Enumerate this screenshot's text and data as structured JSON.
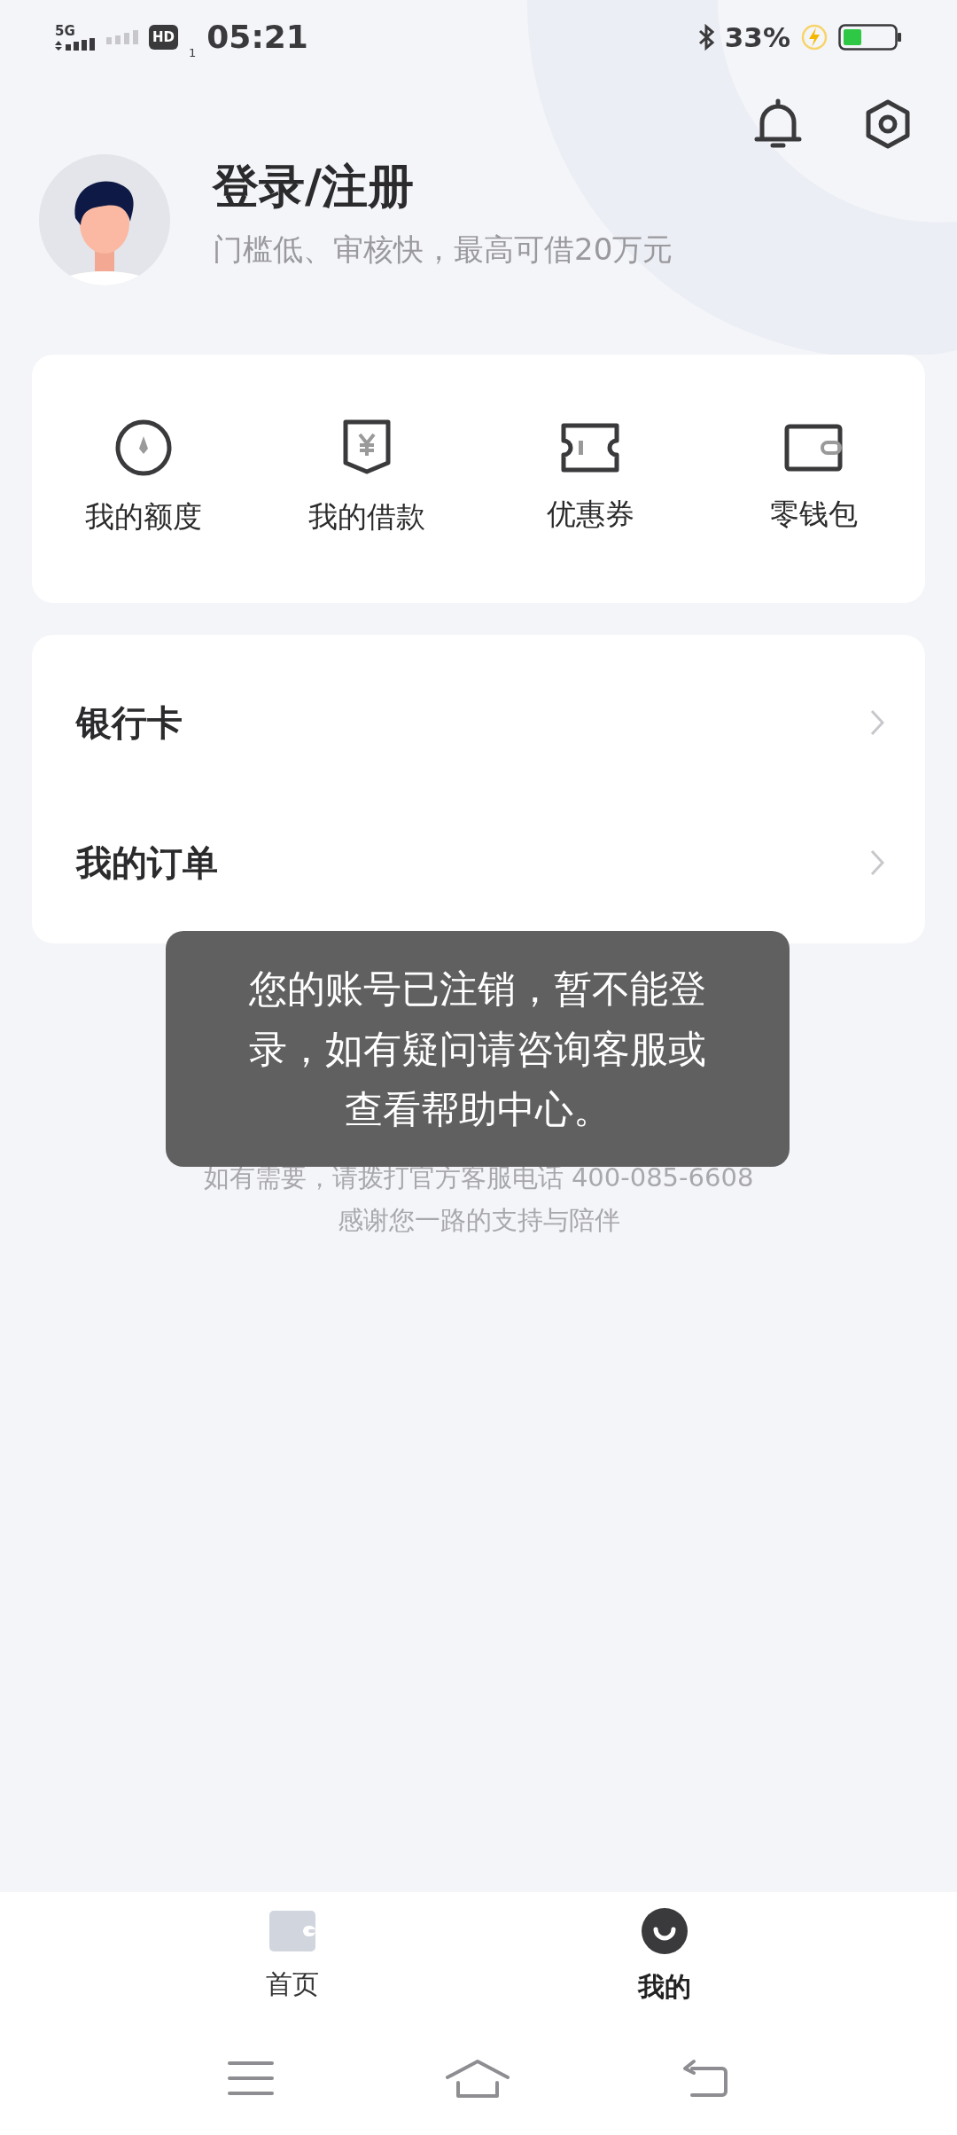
{
  "status_bar": {
    "network": "5G",
    "hd": "HD",
    "sim": "1",
    "time": "05:21",
    "battery_percent": "33%"
  },
  "profile": {
    "title": "登录/注册",
    "subtitle": "门槛低、审核快，最高可借20万元"
  },
  "shortcuts": [
    {
      "kind": "quota",
      "label": "我的额度"
    },
    {
      "kind": "loan",
      "label": "我的借款"
    },
    {
      "kind": "coupon",
      "label": "优惠券"
    },
    {
      "kind": "wallet",
      "label": "零钱包"
    }
  ],
  "menu": [
    {
      "label": "银行卡"
    },
    {
      "label": "我的订单"
    }
  ],
  "toast": {
    "message": "您的账号已注销，暂不能登录，如有疑问请咨询客服或查看帮助中心。"
  },
  "footer": {
    "lines": [
      "如有需要，请拨打官方客服电话 400-085-6608",
      "感谢您一路的支持与陪伴"
    ]
  },
  "tabs": [
    {
      "kind": "home",
      "label": "首页",
      "selected": false
    },
    {
      "kind": "mine",
      "label": "我的",
      "selected": true
    }
  ]
}
